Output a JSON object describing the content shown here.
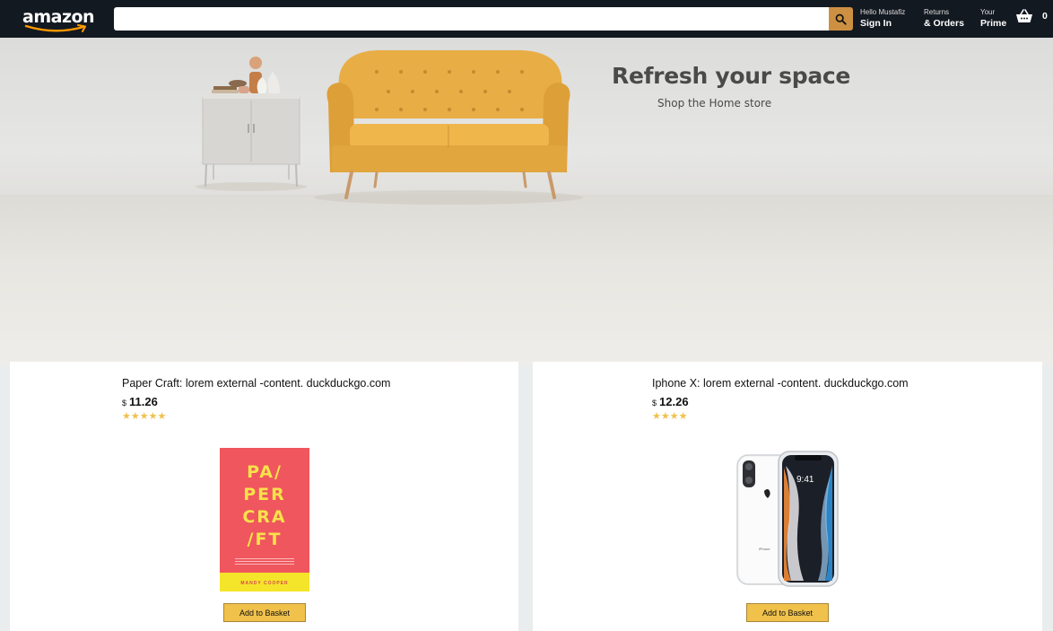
{
  "header": {
    "logo_text": "amazon",
    "search": {
      "value": "",
      "placeholder": ""
    },
    "nav": [
      {
        "line1": "Hello Mustafiz",
        "line2": "Sign In"
      },
      {
        "line1": "Returns",
        "line2": "& Orders"
      },
      {
        "line1": "Your",
        "line2": "Prime"
      }
    ],
    "basket_count": "0"
  },
  "hero": {
    "title": "Refresh your space",
    "subtitle": "Shop the Home store"
  },
  "products": [
    {
      "title": "Paper Craft: lorem external -content. duckduckgo.com",
      "currency": "$",
      "price": "11.26",
      "rating": 5,
      "rating_stars": "★★★★★",
      "button_label": "Add to Basket",
      "image": {
        "cover_title": "PA/\nPER\nCRA\n/FT",
        "cover_author": "MANDY COOPER"
      }
    },
    {
      "title": "Iphone X: lorem external -content. duckduckgo.com",
      "currency": "$",
      "price": "12.26",
      "rating": 4,
      "rating_stars": "★★★★",
      "button_label": "Add to Basket",
      "image": {
        "screen_time": "9:41"
      }
    }
  ],
  "colors": {
    "header_bg": "#131921",
    "search_button": "#cd9042",
    "button_bg": "#f0c14b",
    "star": "#f0c14b",
    "page_bg": "#eaeded",
    "sofa": "#e8ad45",
    "book_cover": "#f0565d",
    "book_text": "#f7e24a"
  },
  "icons": [
    "amazon-smile-icon",
    "search-icon",
    "basket-icon",
    "star-icon"
  ]
}
